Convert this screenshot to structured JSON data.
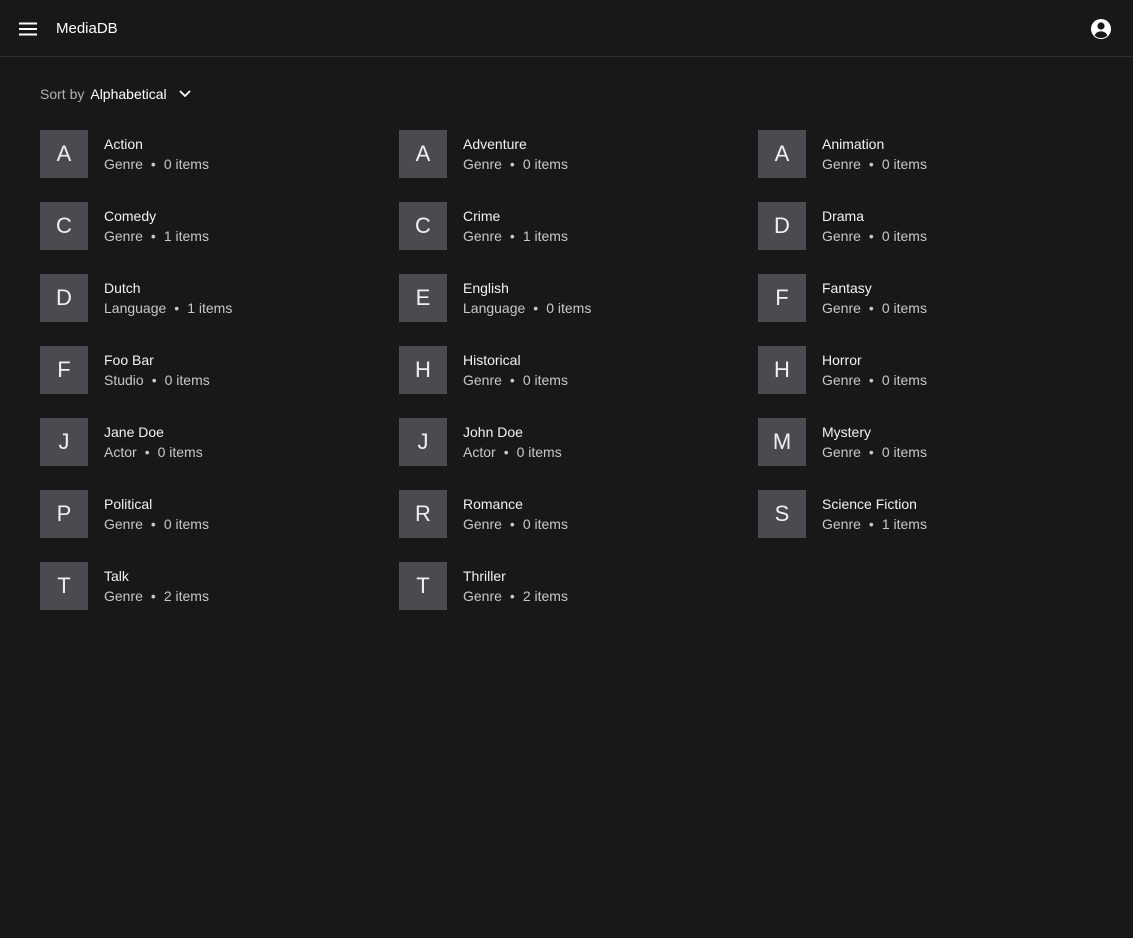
{
  "app": {
    "title": "MediaDB",
    "menu_icon": "menu-icon",
    "account_icon": "account-circle-icon"
  },
  "sort": {
    "label": "Sort by",
    "value": "Alphabetical",
    "icon": "chevron-down-icon"
  },
  "colors": {
    "background": "#181818",
    "avatar_bg": "#4a4a50",
    "text_primary": "#f2f2f2",
    "text_secondary": "#c8c8c8"
  },
  "items": [
    {
      "letter": "A",
      "name": "Action",
      "type": "Genre",
      "count": "0 items"
    },
    {
      "letter": "A",
      "name": "Adventure",
      "type": "Genre",
      "count": "0 items"
    },
    {
      "letter": "A",
      "name": "Animation",
      "type": "Genre",
      "count": "0 items"
    },
    {
      "letter": "C",
      "name": "Comedy",
      "type": "Genre",
      "count": "1 items"
    },
    {
      "letter": "C",
      "name": "Crime",
      "type": "Genre",
      "count": "1 items"
    },
    {
      "letter": "D",
      "name": "Drama",
      "type": "Genre",
      "count": "0 items"
    },
    {
      "letter": "D",
      "name": "Dutch",
      "type": "Language",
      "count": "1 items"
    },
    {
      "letter": "E",
      "name": "English",
      "type": "Language",
      "count": "0 items"
    },
    {
      "letter": "F",
      "name": "Fantasy",
      "type": "Genre",
      "count": "0 items"
    },
    {
      "letter": "F",
      "name": "Foo Bar",
      "type": "Studio",
      "count": "0 items"
    },
    {
      "letter": "H",
      "name": "Historical",
      "type": "Genre",
      "count": "0 items"
    },
    {
      "letter": "H",
      "name": "Horror",
      "type": "Genre",
      "count": "0 items"
    },
    {
      "letter": "J",
      "name": "Jane Doe",
      "type": "Actor",
      "count": "0 items"
    },
    {
      "letter": "J",
      "name": "John Doe",
      "type": "Actor",
      "count": "0 items"
    },
    {
      "letter": "M",
      "name": "Mystery",
      "type": "Genre",
      "count": "0 items"
    },
    {
      "letter": "P",
      "name": "Political",
      "type": "Genre",
      "count": "0 items"
    },
    {
      "letter": "R",
      "name": "Romance",
      "type": "Genre",
      "count": "0 items"
    },
    {
      "letter": "S",
      "name": "Science Fiction",
      "type": "Genre",
      "count": "1 items"
    },
    {
      "letter": "T",
      "name": "Talk",
      "type": "Genre",
      "count": "2 items"
    },
    {
      "letter": "T",
      "name": "Thriller",
      "type": "Genre",
      "count": "2 items"
    }
  ]
}
